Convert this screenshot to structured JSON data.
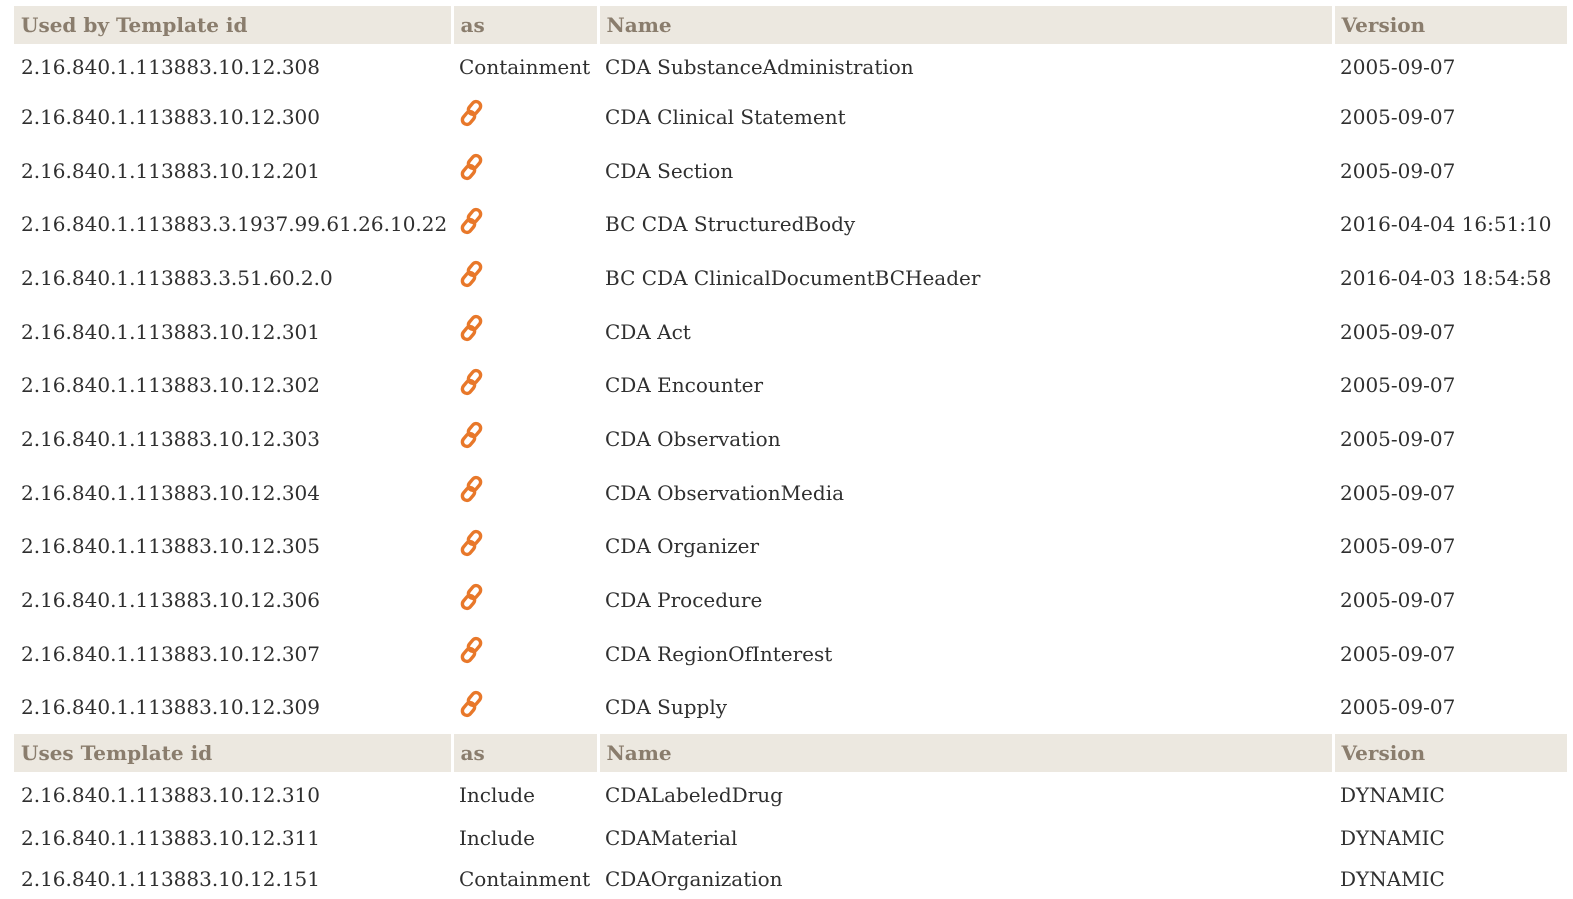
{
  "headers_used_by": {
    "id": "Used by Template id",
    "as": "as",
    "name": "Name",
    "version": "Version"
  },
  "used_by": [
    {
      "id": "2.16.840.1.113883.10.12.308",
      "as": "Containment",
      "name": "CDA SubstanceAdministration",
      "version": "2005-09-07"
    },
    {
      "id": "2.16.840.1.113883.10.12.300",
      "as": "",
      "name": "CDA Clinical Statement",
      "version": "2005-09-07"
    },
    {
      "id": "2.16.840.1.113883.10.12.201",
      "as": "",
      "name": "CDA Section",
      "version": "2005-09-07"
    },
    {
      "id": "2.16.840.1.113883.3.1937.99.61.26.10.22",
      "as": "",
      "name": "BC CDA StructuredBody",
      "version": "2016-04-04 16:51:10"
    },
    {
      "id": "2.16.840.1.113883.3.51.60.2.0",
      "as": "",
      "name": "BC CDA ClinicalDocumentBCHeader",
      "version": "2016-04-03 18:54:58"
    },
    {
      "id": "2.16.840.1.113883.10.12.301",
      "as": "",
      "name": "CDA Act",
      "version": "2005-09-07"
    },
    {
      "id": "2.16.840.1.113883.10.12.302",
      "as": "",
      "name": "CDA Encounter",
      "version": "2005-09-07"
    },
    {
      "id": "2.16.840.1.113883.10.12.303",
      "as": "",
      "name": "CDA Observation",
      "version": "2005-09-07"
    },
    {
      "id": "2.16.840.1.113883.10.12.304",
      "as": "",
      "name": "CDA ObservationMedia",
      "version": "2005-09-07"
    },
    {
      "id": "2.16.840.1.113883.10.12.305",
      "as": "",
      "name": "CDA Organizer",
      "version": "2005-09-07"
    },
    {
      "id": "2.16.840.1.113883.10.12.306",
      "as": "",
      "name": "CDA Procedure",
      "version": "2005-09-07"
    },
    {
      "id": "2.16.840.1.113883.10.12.307",
      "as": "",
      "name": "CDA RegionOfInterest",
      "version": "2005-09-07"
    },
    {
      "id": "2.16.840.1.113883.10.12.309",
      "as": "",
      "name": "CDA Supply",
      "version": "2005-09-07"
    }
  ],
  "headers_uses": {
    "id": "Uses Template id",
    "as": "as",
    "name": "Name",
    "version": "Version"
  },
  "uses": [
    {
      "id": "2.16.840.1.113883.10.12.310",
      "as": "Include",
      "name": "CDALabeledDrug",
      "version": "DYNAMIC"
    },
    {
      "id": "2.16.840.1.113883.10.12.311",
      "as": "Include",
      "name": "CDAMaterial",
      "version": "DYNAMIC"
    },
    {
      "id": "2.16.840.1.113883.10.12.151",
      "as": "Containment",
      "name": "CDAOrganization",
      "version": "DYNAMIC"
    }
  ],
  "icons": {
    "link": "link-icon"
  },
  "colors": {
    "header_bg": "#ece8e0",
    "header_text": "#8a7d6d",
    "link_icon": "#e8782a"
  }
}
